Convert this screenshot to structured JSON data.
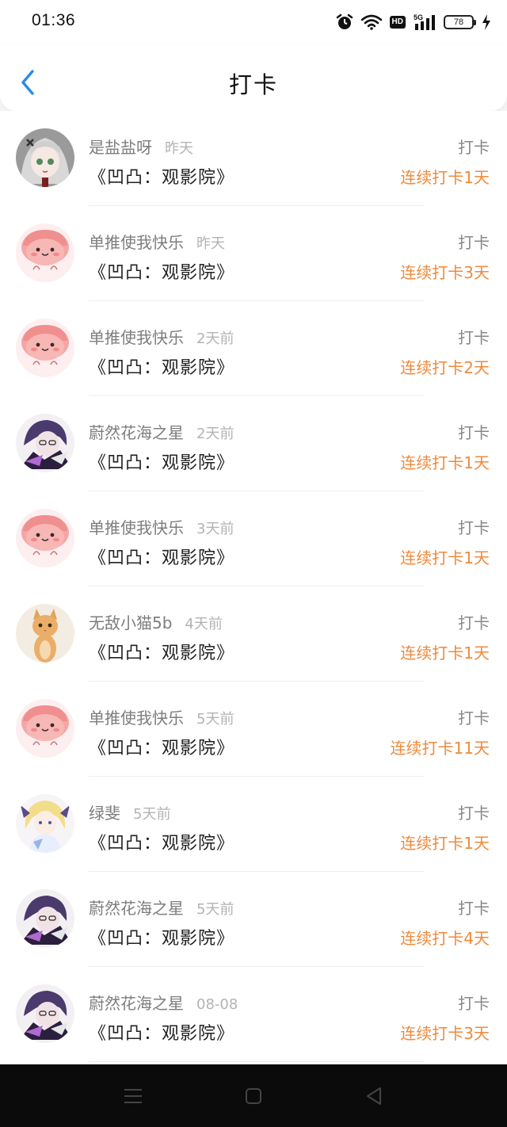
{
  "status_bar": {
    "time": "01:36",
    "battery": "78",
    "icons": [
      "alarm-icon",
      "wifi-icon",
      "hd-icon",
      "5g-signal-icon",
      "battery-icon",
      "charging-icon"
    ],
    "hd_label": "HD",
    "network_label": "5G"
  },
  "header": {
    "back_icon": "chevron-left-icon",
    "title": "打卡"
  },
  "colors": {
    "accent_blue": "#2a8be8",
    "streak_orange": "#ee8a3c",
    "muted_gray": "#7d7d7d",
    "time_gray": "#b3b3b3"
  },
  "checkins": [
    {
      "username": "是盐盐呀",
      "time": "昨天",
      "work": "《凹凸：观影院》",
      "action": "打卡",
      "streak": "连续打卡1天",
      "avatar": "anime-girl-gray"
    },
    {
      "username": "单推使我快乐",
      "time": "昨天",
      "work": "《凹凸：观影院》",
      "action": "打卡",
      "streak": "连续打卡3天",
      "avatar": "pink-blob"
    },
    {
      "username": "单推使我快乐",
      "time": "2天前",
      "work": "《凹凸：观影院》",
      "action": "打卡",
      "streak": "连续打卡2天",
      "avatar": "pink-blob"
    },
    {
      "username": "蔚然花海之星",
      "time": "2天前",
      "work": "《凹凸：观影院》",
      "action": "打卡",
      "streak": "连续打卡1天",
      "avatar": "anime-purple"
    },
    {
      "username": "单推使我快乐",
      "time": "3天前",
      "work": "《凹凸：观影院》",
      "action": "打卡",
      "streak": "连续打卡1天",
      "avatar": "pink-blob"
    },
    {
      "username": "无敌小猫5b",
      "time": "4天前",
      "work": "《凹凸：观影院》",
      "action": "打卡",
      "streak": "连续打卡1天",
      "avatar": "kitten"
    },
    {
      "username": "单推使我快乐",
      "time": "5天前",
      "work": "《凹凸：观影院》",
      "action": "打卡",
      "streak": "连续打卡11天",
      "avatar": "pink-blob"
    },
    {
      "username": "绿斐",
      "time": "5天前",
      "work": "《凹凸：观影院》",
      "action": "打卡",
      "streak": "连续打卡1天",
      "avatar": "anime-blonde"
    },
    {
      "username": "蔚然花海之星",
      "time": "5天前",
      "work": "《凹凸：观影院》",
      "action": "打卡",
      "streak": "连续打卡4天",
      "avatar": "anime-purple"
    },
    {
      "username": "蔚然花海之星",
      "time": "08-08",
      "work": "《凹凸：观影院》",
      "action": "打卡",
      "streak": "连续打卡3天",
      "avatar": "anime-purple"
    }
  ],
  "nav_bar": {
    "buttons": [
      "menu-icon",
      "home-icon",
      "back-triangle-icon"
    ]
  }
}
